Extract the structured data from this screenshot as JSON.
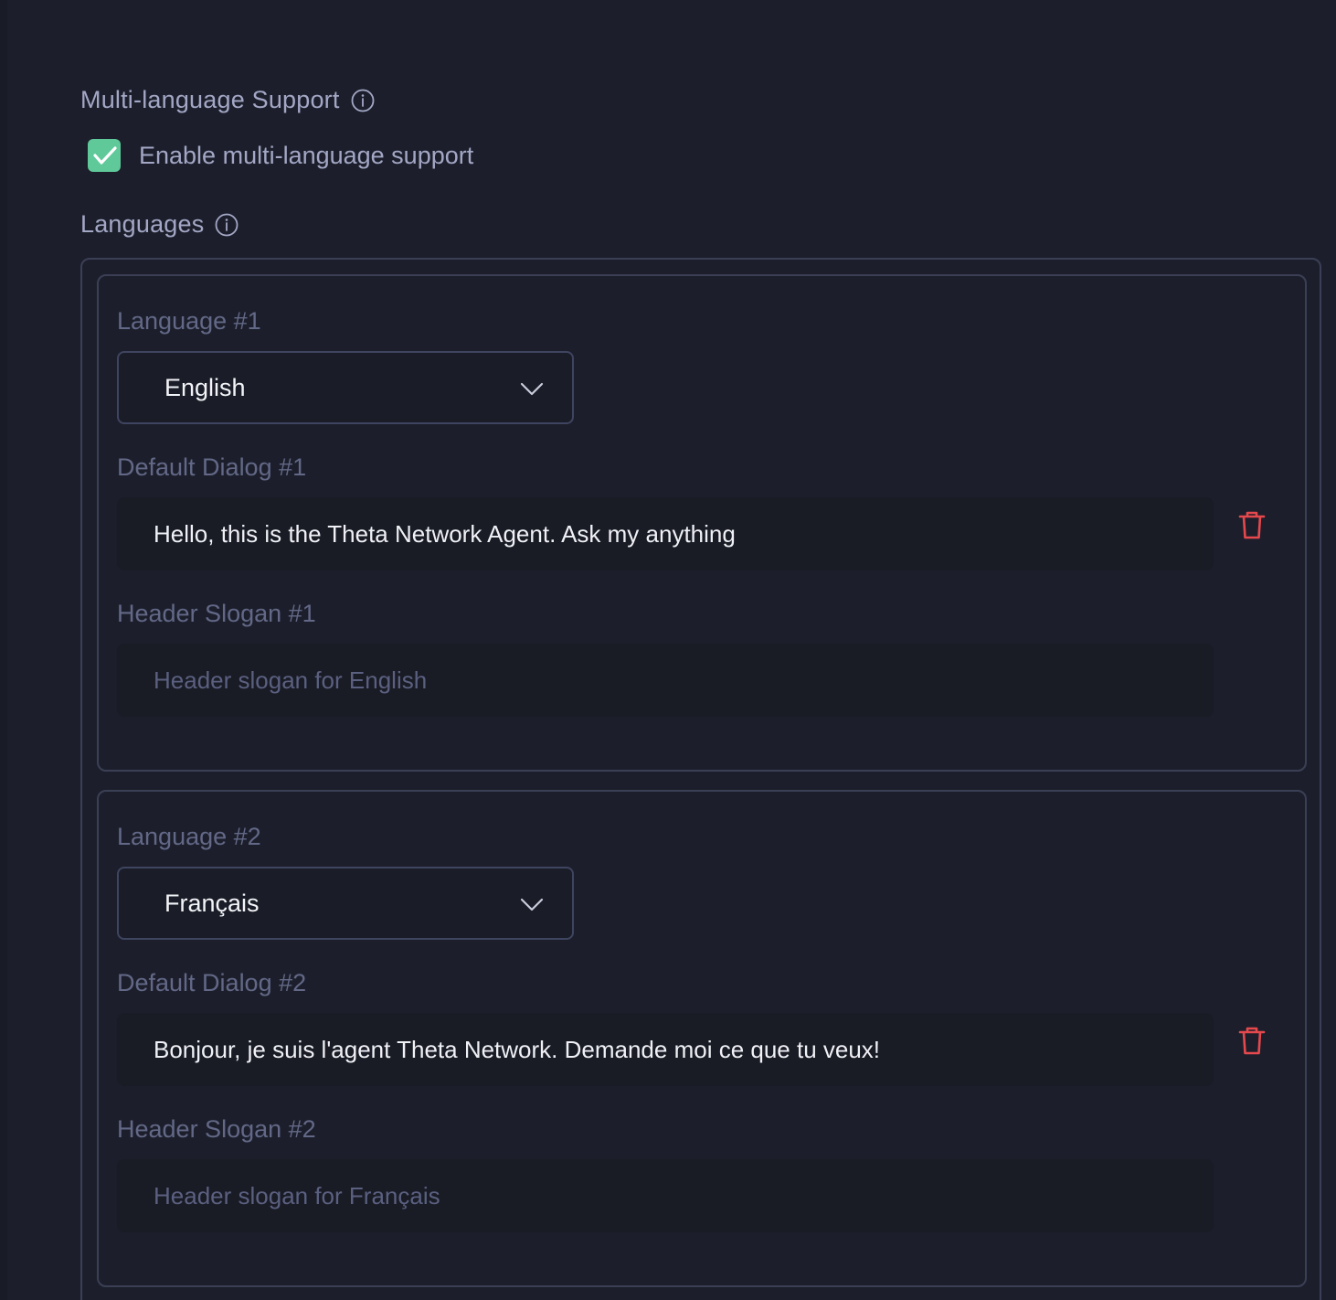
{
  "multi_language": {
    "title": "Multi-language Support",
    "enable_label": "Enable multi-language support",
    "enabled": true
  },
  "languages": {
    "title": "Languages",
    "items": [
      {
        "language_label": "Language #1",
        "language_value": "English",
        "dialog_label": "Default Dialog #1",
        "dialog_value": "Hello, this is the Theta Network Agent. Ask my anything",
        "slogan_label": "Header Slogan #1",
        "slogan_placeholder": "Header slogan for English"
      },
      {
        "language_label": "Language #2",
        "language_value": "Français",
        "dialog_label": "Default Dialog #2",
        "dialog_value": "Bonjour, je suis l'agent Theta Network. Demande moi ce que tu veux!",
        "slogan_label": "Header Slogan #2",
        "slogan_placeholder": "Header slogan for Français"
      }
    ]
  },
  "icons": {
    "info": "info-icon",
    "check": "check-icon",
    "chevron": "chevron-down-icon",
    "trash": "trash-icon"
  },
  "colors": {
    "background": "#1c1f2b",
    "accent_check": "#5fc99a",
    "delete": "#e5484d"
  }
}
